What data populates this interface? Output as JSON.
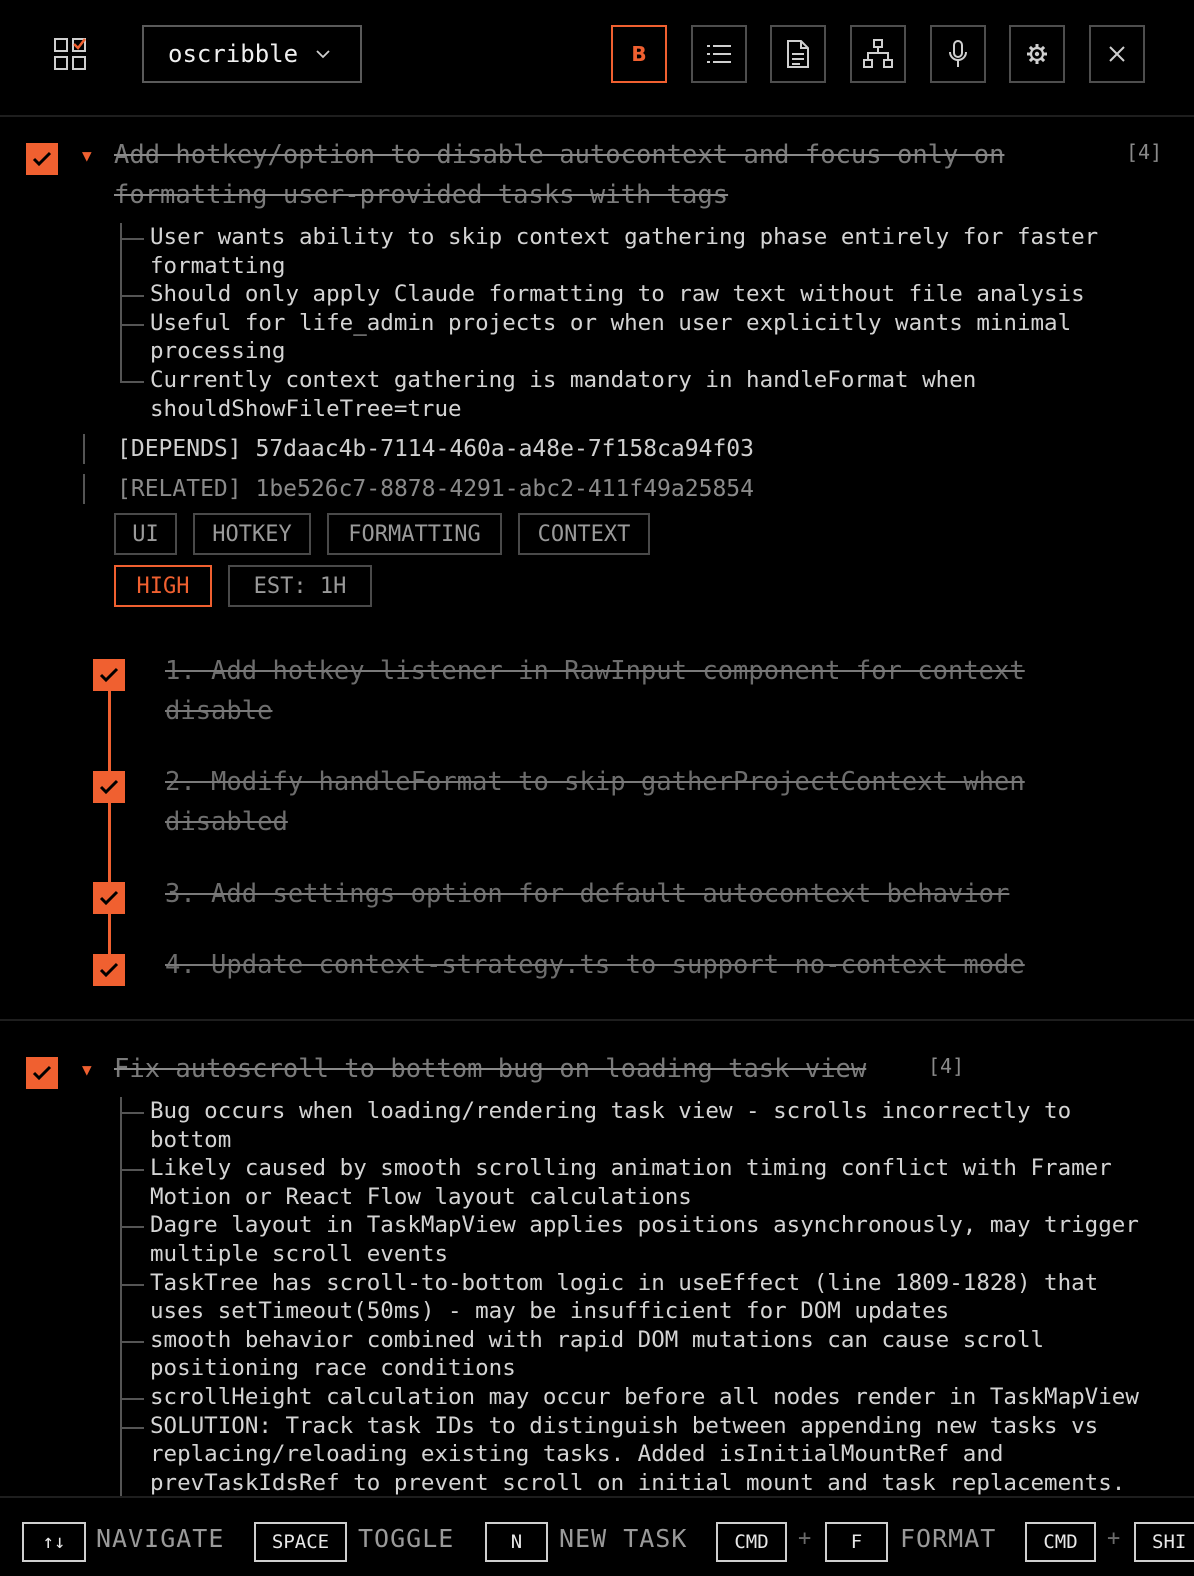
{
  "header": {
    "project_name": "oscribble",
    "buttons": [
      {
        "name": "bold",
        "label": "B",
        "active": true
      },
      {
        "name": "list-view",
        "active": false
      },
      {
        "name": "document-view",
        "active": false
      },
      {
        "name": "map-view",
        "active": false
      },
      {
        "name": "voice-input",
        "active": false
      },
      {
        "name": "settings",
        "active": false
      },
      {
        "name": "close",
        "active": false
      }
    ],
    "accent_color": "#f06030"
  },
  "tasks": [
    {
      "title_line1": "Add hotkey/option to disable autocontext and focus only on",
      "title_line2": "formatting user-provided tasks with tags",
      "count": "[4]",
      "completed": true,
      "notes": [
        {
          "line1": "User wants ability to skip context gathering phase entirely for faster",
          "line2": "formatting"
        },
        {
          "line1": "Should only apply Claude formatting to raw text without file analysis",
          "line2": ""
        },
        {
          "line1": "Useful for life_admin projects or when user explicitly wants minimal",
          "line2": "processing"
        },
        {
          "line1": "Currently context gathering is mandatory in handleFormat when",
          "line2": "shouldShowFileTree=true"
        }
      ],
      "depends": {
        "label": "[DEPENDS]",
        "id": "57daac4b-7114-460a-a48e-7f158ca94f03"
      },
      "related": {
        "label": "[RELATED]",
        "id": "1be526c7-8878-4291-abc2-411f49a25854"
      },
      "tags": [
        "UI",
        "HOTKEY",
        "FORMATTING",
        "CONTEXT"
      ],
      "priority": "HIGH",
      "estimate": "EST: 1H",
      "subtasks": [
        {
          "line1": "1. Add hotkey listener in RawInput component for context",
          "line2": "disable",
          "completed": true
        },
        {
          "line1": "2. Modify handleFormat to skip gatherProjectContext when",
          "line2": "disabled",
          "completed": true
        },
        {
          "line1": "3. Add settings option for default autocontext behavior",
          "line2": "",
          "completed": true
        },
        {
          "line1": "4. Update context-strategy.ts to support no-context mode",
          "line2": "",
          "completed": true
        }
      ]
    },
    {
      "title_line1": "Fix autoscroll to bottom bug on loading task view",
      "count": "[4]",
      "completed": true,
      "notes": [
        {
          "line1": "Bug occurs when loading/rendering task view - scrolls incorrectly to",
          "line2": "bottom"
        },
        {
          "line1": "Likely caused by smooth scrolling animation timing conflict with Framer",
          "line2": "Motion or React Flow layout calculations"
        },
        {
          "line1": "Dagre layout in TaskMapView applies positions asynchronously, may trigger",
          "line2": "multiple scroll events"
        },
        {
          "line1": "TaskTree has scroll-to-bottom logic in useEffect (line 1809-1828) that",
          "line2": "uses setTimeout(50ms) - may be insufficient for DOM updates"
        },
        {
          "line1": "smooth behavior combined with rapid DOM mutations can cause scroll",
          "line2": "positioning race conditions"
        },
        {
          "line1": "scrollHeight calculation may occur before all nodes render in TaskMapView",
          "line2": ""
        },
        {
          "line1": "SOLUTION: Track task IDs to distinguish between appending new tasks vs",
          "line2": "replacing/reloading existing tasks. Added isInitialMountRef and",
          "line3": "prevTaskIdsRef to prevent scroll on initial mount and task replacements."
        }
      ]
    }
  ],
  "footer": {
    "shortcuts": [
      {
        "key": "↑↓",
        "label": "NAVIGATE"
      },
      {
        "key": "SPACE",
        "label": "TOGGLE"
      },
      {
        "key": "N",
        "label": "NEW TASK"
      },
      {
        "key": "CMD",
        "key2": "F",
        "label": "FORMAT"
      },
      {
        "key": "CMD",
        "key2": "SHI"
      }
    ],
    "plus": "+"
  }
}
